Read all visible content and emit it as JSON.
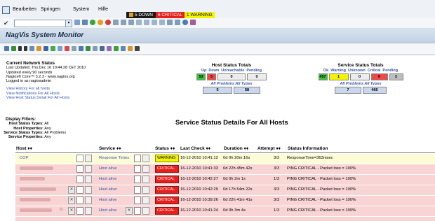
{
  "menubar": {
    "items": [
      "Bearbeiten",
      "Springen",
      "System",
      "Hilfe"
    ],
    "status": {
      "down": "5 DOWN",
      "critical": "6 CRITICAL",
      "warning": "1 WARNING"
    }
  },
  "app": {
    "title": "NagVis System Monitor"
  },
  "network": {
    "heading": "Current Network Status",
    "last_updated": "Last Updated: Thu Dec 16 10:44:28 CET 2010",
    "interval": "Updated every 90 seconds",
    "version": "Nagios® Core™ 3.2.3 - www.nagios.org",
    "login": "Logged in as nagiosadmin",
    "links": [
      "View History For all hosts",
      "View Notifications For All Hosts",
      "View Host Status Detail For All Hosts"
    ]
  },
  "host_totals": {
    "heading": "Host Status Totals",
    "labels": [
      "Up",
      "Down",
      "Unreachable",
      "Pending"
    ],
    "values": [
      "53",
      "5",
      "0",
      "0"
    ],
    "sub_labels": "All Problems  All Types",
    "sub_values": [
      "5",
      "58"
    ]
  },
  "service_totals": {
    "heading": "Service Status Totals",
    "labels": [
      "Ok",
      "Warning",
      "Unknown",
      "Critical",
      "Pending"
    ],
    "values": [
      "457",
      "1",
      "0",
      "6",
      "2"
    ],
    "sub_labels": "All Problems  All Types",
    "sub_values": [
      "7",
      "466"
    ]
  },
  "filters": {
    "heading": "Display Filters:",
    "rows": [
      {
        "k": "Host Status Types:",
        "v": "All"
      },
      {
        "k": "Host Properties:",
        "v": "Any"
      },
      {
        "k": "Service Status Types:",
        "v": "All Problems"
      },
      {
        "k": "Service Properties:",
        "v": "Any"
      }
    ]
  },
  "main": {
    "title": "Service Status Details For All Hosts"
  },
  "table": {
    "headers": [
      "Host ♦♦",
      "Service ♦♦",
      "Status ♦♦",
      "Last Check ♦♦",
      "Duration ♦♦",
      "Attempt ♦♦",
      "Status Information"
    ],
    "rows": [
      {
        "host": "COP",
        "service": "Response Times",
        "status": "WARNING",
        "last": "16-12-2010 10:41:12",
        "dur": "0d 0h 20m 16s",
        "att": "3/3",
        "info": "ResponseTime=363msec"
      },
      {
        "host": "",
        "service": "Host alive",
        "status": "CRITICAL",
        "last": "16-12-2010 10:41:33",
        "dur": "0d 22h 45m 42s",
        "att": "3/3",
        "info": "PING CRITICAL - Packet loss = 100%"
      },
      {
        "host": "",
        "service": "Host alive",
        "status": "CRITICAL",
        "last": "16-12-2010 10:42:27",
        "dur": "0d 0h 2m 1s",
        "att": "1/3",
        "info": "PING CRITICAL - Packet loss = 100%"
      },
      {
        "host": "",
        "service": "Host alive",
        "status": "CRITICAL",
        "last": "16-12-2010 10:42:29",
        "dur": "0d 17h 54m 22s",
        "att": "3/3",
        "info": "PING CRITICAL - Packet loss = 100%"
      },
      {
        "host": "",
        "service": "Host alive",
        "status": "CRITICAL",
        "last": "16-12-2010 10:39:26",
        "dur": "0d 22h 41m 41s",
        "att": "3/3",
        "info": "PING CRITICAL - Packet loss = 100%"
      },
      {
        "host": "",
        "service": "Host alive",
        "status": "CRITICAL",
        "last": "16-12-2010 10:41:24",
        "dur": "0d 0h 3m 4s",
        "att": "1/3",
        "info": "PING CRITICAL - Packet loss = 100%"
      }
    ]
  },
  "colors": {
    "warning_row": "#fcfcd6",
    "critical_row": "#f8d4d4",
    "warning_badge": "#f4f400",
    "critical_badge": "#e8201c",
    "link": "#3355aa"
  }
}
